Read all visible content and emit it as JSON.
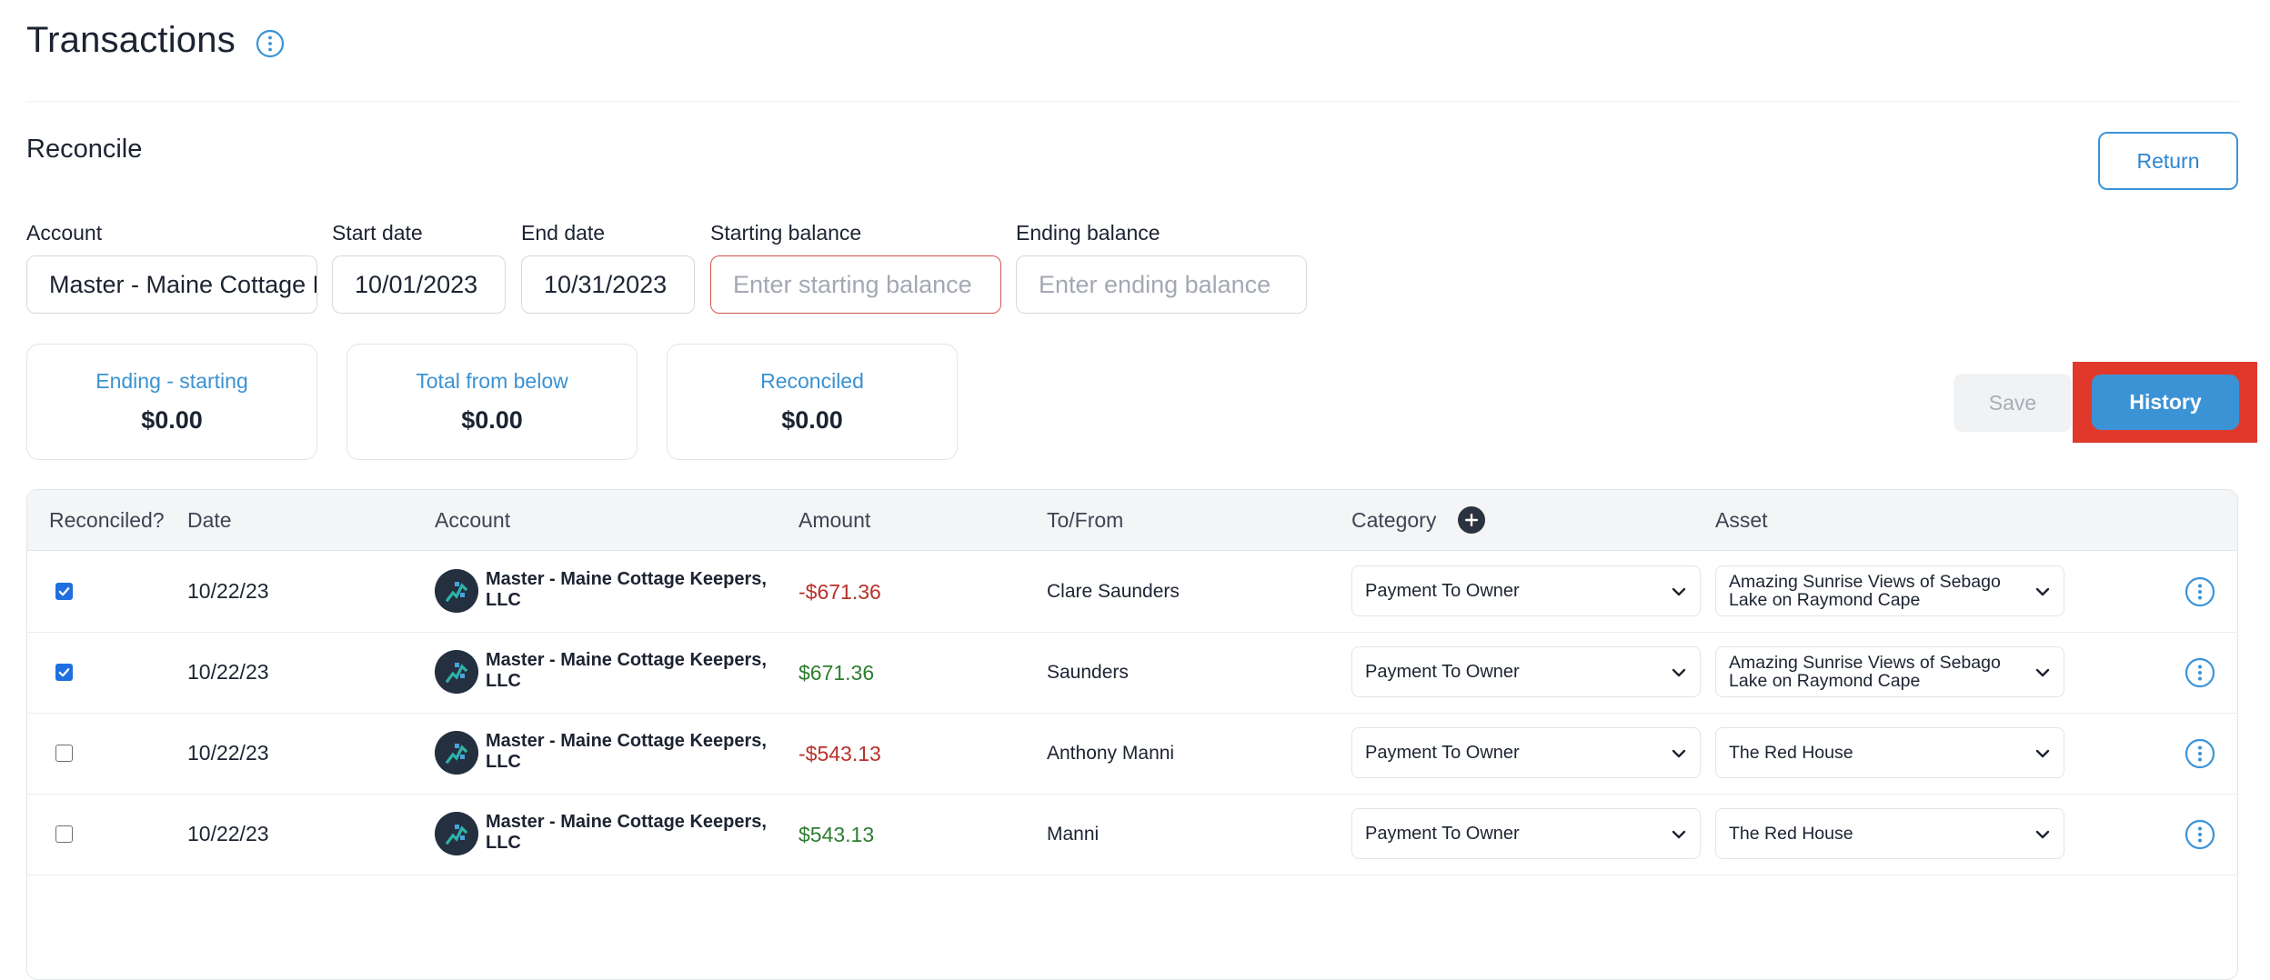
{
  "header": {
    "title": "Transactions"
  },
  "reconcile": {
    "title": "Reconcile",
    "return_label": "Return",
    "fields": {
      "account": {
        "label": "Account",
        "value": "Master - Maine Cottage Keepers, LLC"
      },
      "start_date": {
        "label": "Start date",
        "value": "10/01/2023"
      },
      "end_date": {
        "label": "End date",
        "value": "10/31/2023"
      },
      "starting_balance": {
        "label": "Starting balance",
        "placeholder": "Enter starting balance"
      },
      "ending_balance": {
        "label": "Ending balance",
        "placeholder": "Enter ending balance"
      }
    },
    "cards": [
      {
        "label": "Ending - starting",
        "value": "$0.00"
      },
      {
        "label": "Total from below",
        "value": "$0.00"
      },
      {
        "label": "Reconciled",
        "value": "$0.00"
      }
    ],
    "save_label": "Save",
    "history_label": "History"
  },
  "table": {
    "headers": {
      "reconciled": "Reconciled?",
      "date": "Date",
      "account": "Account",
      "amount": "Amount",
      "tofrom": "To/From",
      "category": "Category",
      "asset": "Asset"
    },
    "rows": [
      {
        "checked": true,
        "date": "10/22/23",
        "account": "Master - Maine Cottage Keepers, LLC",
        "amount": "-$671.36",
        "tofrom": "Clare Saunders",
        "category": "Payment To Owner",
        "asset": "Amazing Sunrise Views of Sebago Lake on Raymond Cape"
      },
      {
        "checked": true,
        "date": "10/22/23",
        "account": "Master - Maine Cottage Keepers, LLC",
        "amount": "$671.36",
        "tofrom": "Saunders",
        "category": "Payment To Owner",
        "asset": "Amazing Sunrise Views of Sebago Lake on Raymond Cape"
      },
      {
        "checked": false,
        "date": "10/22/23",
        "account": "Master - Maine Cottage Keepers, LLC",
        "amount": "-$543.13",
        "tofrom": "Anthony Manni",
        "category": "Payment To Owner",
        "asset": "The Red House"
      },
      {
        "checked": false,
        "date": "10/22/23",
        "account": "Master - Maine Cottage Keepers, LLC",
        "amount": "$543.13",
        "tofrom": "Manni",
        "category": "Payment To Owner",
        "asset": "The Red House"
      }
    ]
  },
  "colors": {
    "accent": "#3b93d6",
    "negative": "#b8322a",
    "positive": "#2e7d32",
    "highlight": "#e0392b"
  },
  "icons": {
    "title_info": "info-icon",
    "category_add": "plus-circle-icon",
    "row_menu": "kebab-menu-icon",
    "select_chevron": "chevron-down-icon",
    "account_avatar": "logo-avatar-icon"
  }
}
